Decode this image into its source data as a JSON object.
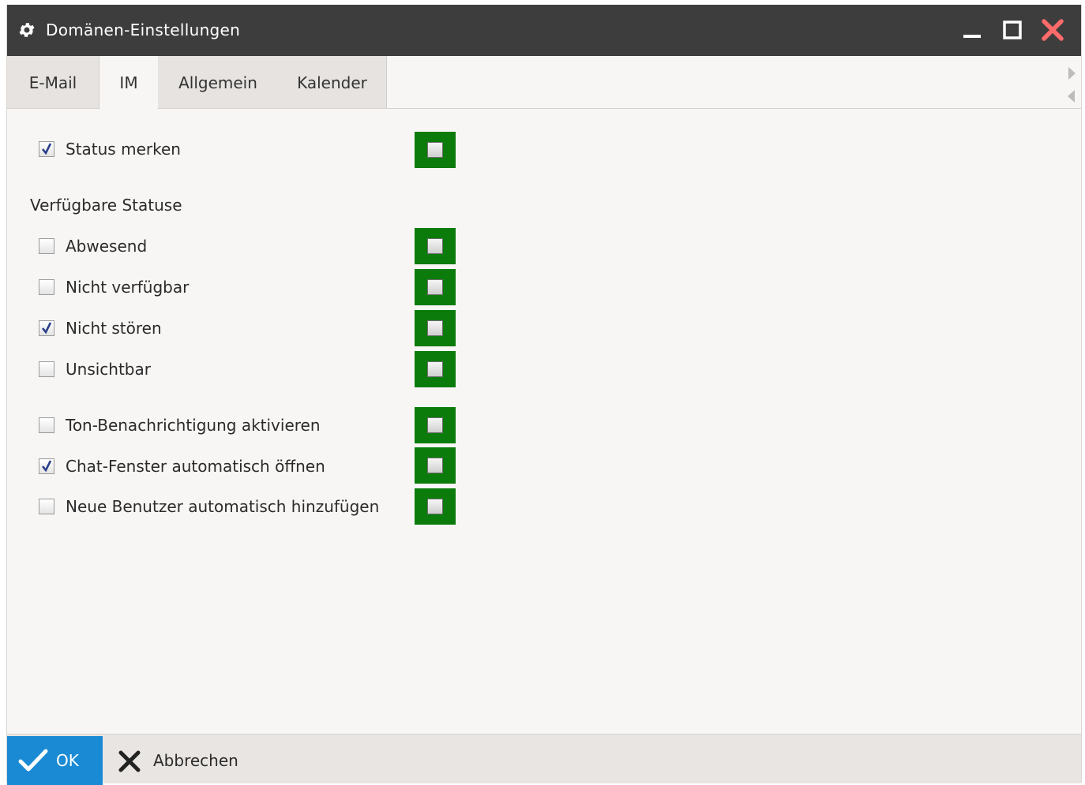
{
  "window": {
    "title": "Domänen-Einstellungen",
    "colors": {
      "titlebar": "#3d3d3d",
      "close": "#ff6b6b",
      "accent": "#1a8ad4",
      "lock": "#0b7b0b"
    }
  },
  "tabs": [
    {
      "label": "E-Mail",
      "active": false
    },
    {
      "label": "IM",
      "active": true
    },
    {
      "label": "Allgemein",
      "active": false
    },
    {
      "label": "Kalender",
      "active": false
    }
  ],
  "settings": {
    "status_merken": {
      "label": "Status merken",
      "checked": true
    },
    "section_title": "Verfügbare Statuse",
    "statuses": [
      {
        "label": "Abwesend",
        "checked": false
      },
      {
        "label": "Nicht verfügbar",
        "checked": false
      },
      {
        "label": "Nicht stören",
        "checked": true
      },
      {
        "label": "Unsichtbar",
        "checked": false
      }
    ],
    "options": [
      {
        "label": "Ton-Benachrichtigung aktivieren",
        "checked": false
      },
      {
        "label": "Chat-Fenster automatisch öffnen",
        "checked": true
      },
      {
        "label": "Neue Benutzer automatisch hinzufügen",
        "checked": false
      }
    ]
  },
  "footer": {
    "ok_label": "OK",
    "cancel_label": "Abbrechen"
  }
}
